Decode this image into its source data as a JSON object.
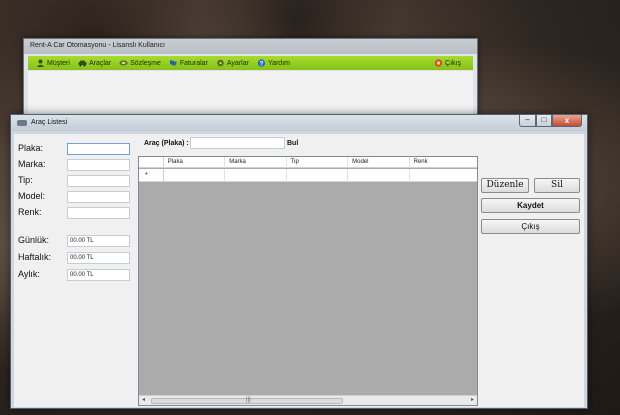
{
  "main_window": {
    "title": "Rent-A Car Otomasyonu - Lisanslı Kullanıcı",
    "menu": [
      {
        "label": "Müşteri",
        "icon": "user-icon"
      },
      {
        "label": "Araçlar",
        "icon": "car-icon"
      },
      {
        "label": "Sözleşme",
        "icon": "handshake-icon"
      },
      {
        "label": "Faturalar",
        "icon": "invoice-icon"
      },
      {
        "label": "Ayarlar",
        "icon": "gear-icon"
      },
      {
        "label": "Yardım",
        "icon": "help-icon"
      }
    ],
    "exit_label": "Çıkış"
  },
  "window": {
    "title": "Araç Listesi",
    "controls": {
      "minimize": "–",
      "maximize": "□",
      "close": "x"
    }
  },
  "form": {
    "plaka_label": "Plaka:",
    "marka_label": "Marka:",
    "tip_label": "Tip:",
    "model_label": "Model:",
    "renk_label": "Renk:",
    "gunluk_label": "Günlük:",
    "gunluk_value": "00.00 TL",
    "haftalik_label": "Haftalık:",
    "haftalik_value": "00.00 TL",
    "aylik_label": "Aylık:",
    "aylik_value": "00.00 TL"
  },
  "search": {
    "label": "Araç (Plaka) :",
    "button": "Bul"
  },
  "grid": {
    "columns": [
      "Plaka",
      "Marka",
      "Tip",
      "Model",
      "Renk"
    ],
    "new_row_marker": "*",
    "scroll_left": "◂",
    "scroll_right": "▸",
    "scroll_grip": "|||"
  },
  "buttons": {
    "duzenle": "Düzenle",
    "sil": "Sil",
    "kaydet": "Kaydet",
    "cikis": "Çıkış"
  },
  "colors": {
    "menubar": "#8cc81e",
    "grid_background": "#ababab"
  }
}
